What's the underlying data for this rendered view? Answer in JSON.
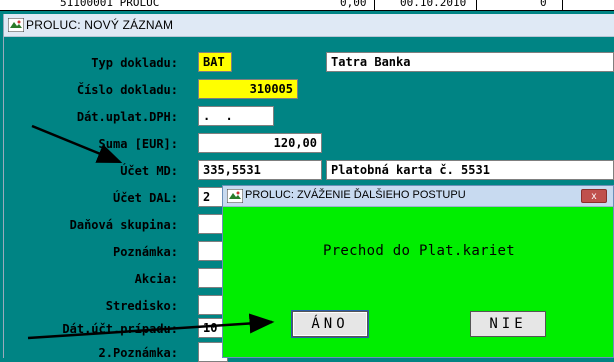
{
  "background_strip": {
    "left": "51100001  PROLUC",
    "mid": "0,00",
    "date": "00.10.2010",
    "end": "0"
  },
  "main_window": {
    "title": "PROLUC: NOVÝ ZÁZNAM"
  },
  "form": {
    "typ_dokladu": {
      "label": "Typ dokladu:",
      "code": "BAT",
      "desc": "Tatra Banka"
    },
    "cislo_dokladu": {
      "label": "Číslo dokladu:",
      "value": "310005"
    },
    "dat_uplat_dph": {
      "label": "Dát.uplat.DPH:",
      "value": ". ."
    },
    "suma": {
      "label": "Suma [EUR]:",
      "value": "120,00"
    },
    "ucet_md": {
      "label": "Účet MD:",
      "value": "335,5531",
      "desc": "Platobná karta č. 5531"
    },
    "ucet_dal": {
      "label": "Účet DAL:",
      "value": "2"
    },
    "danova_skupina": {
      "label": "Daňová skupina:"
    },
    "poznamka": {
      "label": "Poznámka:"
    },
    "akcia": {
      "label": "Akcia:"
    },
    "stredisko": {
      "label": "Stredisko:"
    },
    "dat_uct_pripadu": {
      "label": "Dát.účt.prípadu:",
      "value": "10"
    },
    "poznamka2": {
      "label": "2.Poznámka:"
    }
  },
  "dialog": {
    "title": "PROLUC: ZVÁŽENIE ĎALŠIEHO POSTUPU",
    "close_label": "x",
    "message": "Prechod do Plat.kariet",
    "yes_label": "ÁNO",
    "no_label": "NIE"
  },
  "colors": {
    "teal": "#008484",
    "dialog_green": "#00ee00",
    "yellow": "#ffff00"
  }
}
